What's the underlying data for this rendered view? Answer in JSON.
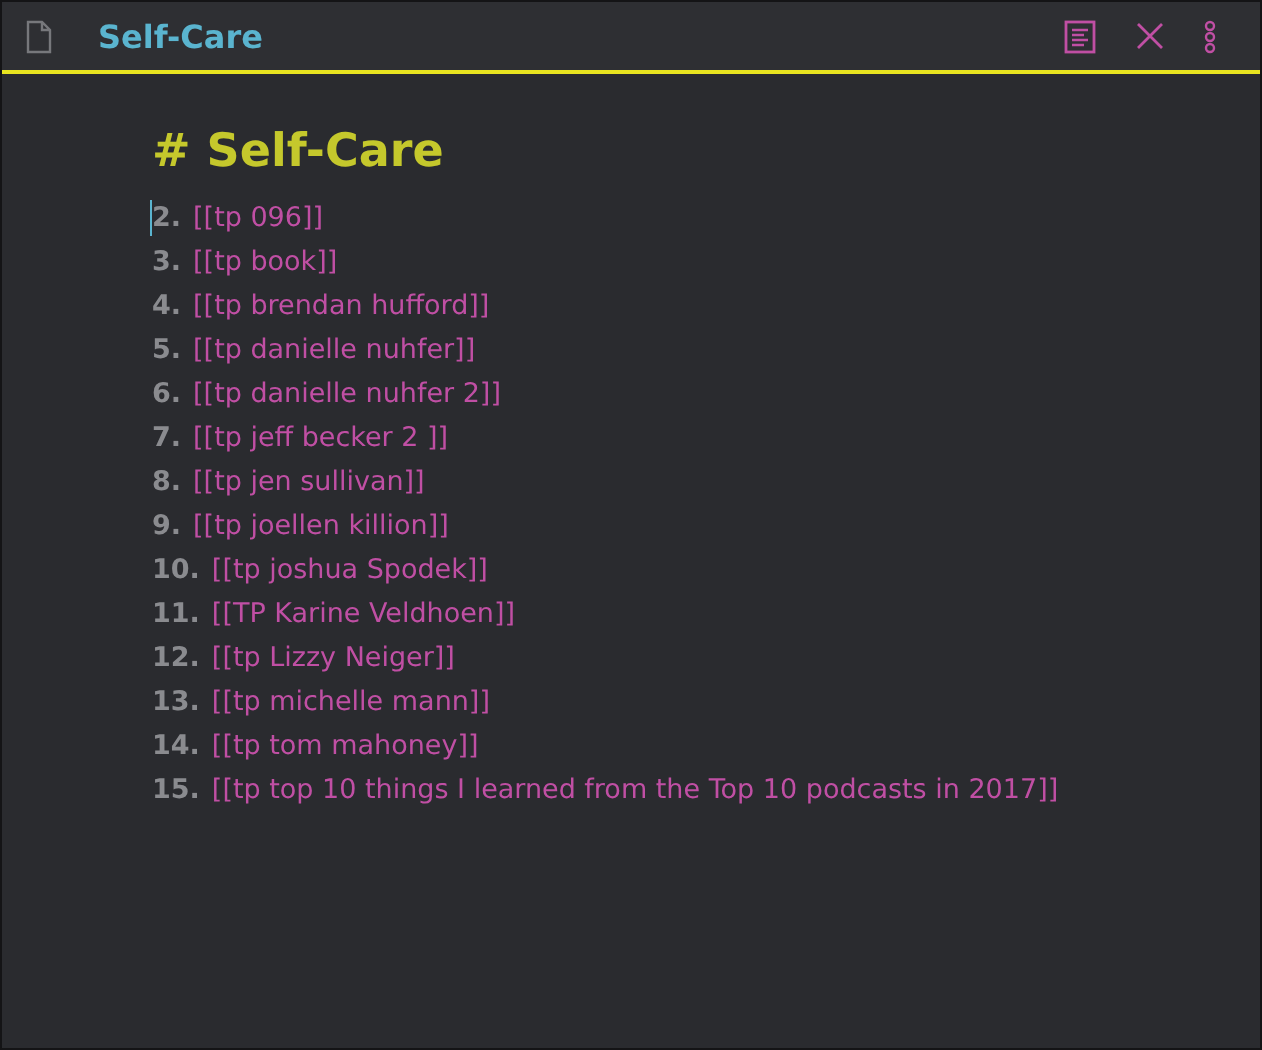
{
  "window": {
    "title": "Self-Care"
  },
  "heading": "# Self-Care",
  "items": [
    {
      "number": "2.",
      "link": "[[tp 096]]"
    },
    {
      "number": "3.",
      "link": "[[tp book]]"
    },
    {
      "number": "4.",
      "link": "[[tp brendan hufford]]"
    },
    {
      "number": "5.",
      "link": "[[tp danielle nuhfer]]"
    },
    {
      "number": "6.",
      "link": "[[tp danielle nuhfer 2]]"
    },
    {
      "number": "7.",
      "link": "[[tp jeff becker 2 ]]"
    },
    {
      "number": "8.",
      "link": "[[tp jen sullivan]]"
    },
    {
      "number": "9.",
      "link": "[[tp joellen killion]]"
    },
    {
      "number": "10.",
      "link": "[[tp joshua Spodek]]"
    },
    {
      "number": "11.",
      "link": "[[TP Karine Veldhoen]]"
    },
    {
      "number": "12.",
      "link": "[[tp Lizzy Neiger]]"
    },
    {
      "number": "13.",
      "link": "[[tp michelle mann]]"
    },
    {
      "number": "14.",
      "link": "[[tp tom mahoney]]"
    },
    {
      "number": "15.",
      "link": "[[tp top 10 things I learned from the Top 10 podcasts in 2017]]"
    }
  ]
}
